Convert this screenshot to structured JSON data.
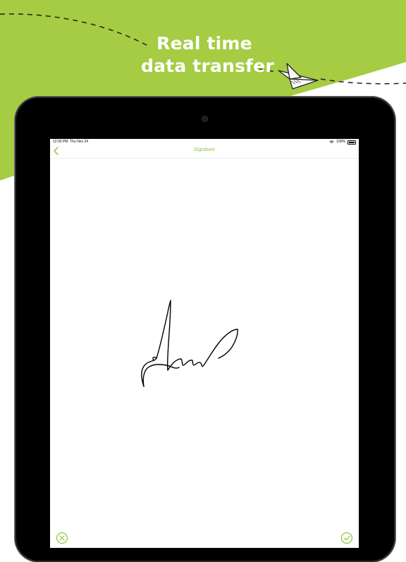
{
  "banner": {
    "line1": "Real time",
    "line2": "data transfer"
  },
  "colors": {
    "accent": "#8dc63f",
    "banner_green": "#a5cc43",
    "device": "#000000"
  },
  "status_bar": {
    "time": "12:03 PM",
    "date": "Thu Nov 24",
    "battery": "100%"
  },
  "nav": {
    "title": "Signature",
    "back_icon": "chevron-left-icon"
  },
  "actions": {
    "clear_icon": "circle-x-icon",
    "confirm_icon": "circle-check-icon"
  }
}
